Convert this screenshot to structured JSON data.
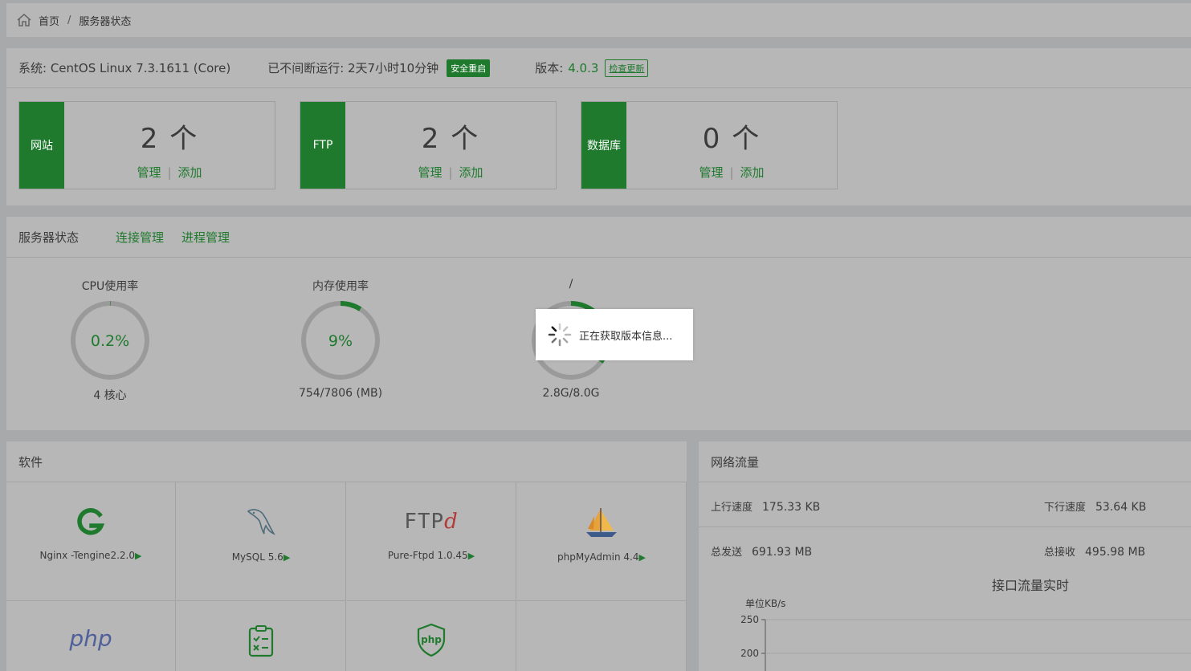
{
  "breadcrumb": {
    "home": "首页",
    "separator": "/",
    "current": "服务器状态"
  },
  "system": {
    "os": "系统: CentOS Linux 7.3.1611 (Core)",
    "uptime": "已不间断运行: 2天7小时10分钟",
    "restart_label": "安全重启",
    "version_label": "版本:",
    "version_value": "4.0.3",
    "update_label": "检查更新"
  },
  "cards": [
    {
      "tag": "网站",
      "count": "2 个",
      "manage": "管理",
      "add": "添加"
    },
    {
      "tag": "FTP",
      "count": "2 个",
      "manage": "管理",
      "add": "添加"
    },
    {
      "tag": "数据库",
      "count": "0 个",
      "manage": "管理",
      "add": "添加"
    }
  ],
  "link_separator": "|",
  "status": {
    "title": "服务器状态",
    "conn_link": "连接管理",
    "proc_link": "进程管理",
    "gauges": [
      {
        "label": "CPU使用率",
        "value": "0.2%",
        "fraction": 0.002,
        "sub": "4 核心"
      },
      {
        "label": "内存使用率",
        "value": "9%",
        "fraction": 0.09,
        "sub": "754/7806 (MB)"
      },
      {
        "label": "/",
        "value": "",
        "fraction": 0.35,
        "sub": "2.8G/8.0G"
      }
    ]
  },
  "loading": {
    "text": "正在获取版本信息..."
  },
  "software": {
    "title": "软件",
    "items": [
      {
        "name": "Nginx -Tengine2.2.0",
        "icon": "nginx-icon"
      },
      {
        "name": "MySQL 5.6",
        "icon": "mysql-icon"
      },
      {
        "name": "Pure-Ftpd 1.0.45",
        "icon": "ftpd-icon"
      },
      {
        "name": "phpMyAdmin 4.4",
        "icon": "phpmyadmin-icon"
      },
      {
        "name": "",
        "icon": "php-icon"
      },
      {
        "name": "",
        "icon": "clipboard-icon"
      },
      {
        "name": "",
        "icon": "php-shield-icon"
      }
    ],
    "arrow": "▶",
    "ftpd_text": "FTP",
    "ftpd_d": "d",
    "php_text": "php",
    "shield_text": "php"
  },
  "network": {
    "title": "网络流量",
    "up_label": "上行速度",
    "up_value": "175.33 KB",
    "down_label": "下行速度",
    "down_value": "53.64 KB",
    "sent_label": "总发送",
    "sent_value": "691.93 MB",
    "recv_label": "总接收",
    "recv_value": "495.98 MB",
    "chart_title": "接口流量实时",
    "unit": "单位KB/s",
    "ticks": [
      "250",
      "200"
    ]
  },
  "colors": {
    "accent": "#1f7a2e",
    "ring": "#9a9a9a",
    "panel": "#b7b7b7"
  }
}
